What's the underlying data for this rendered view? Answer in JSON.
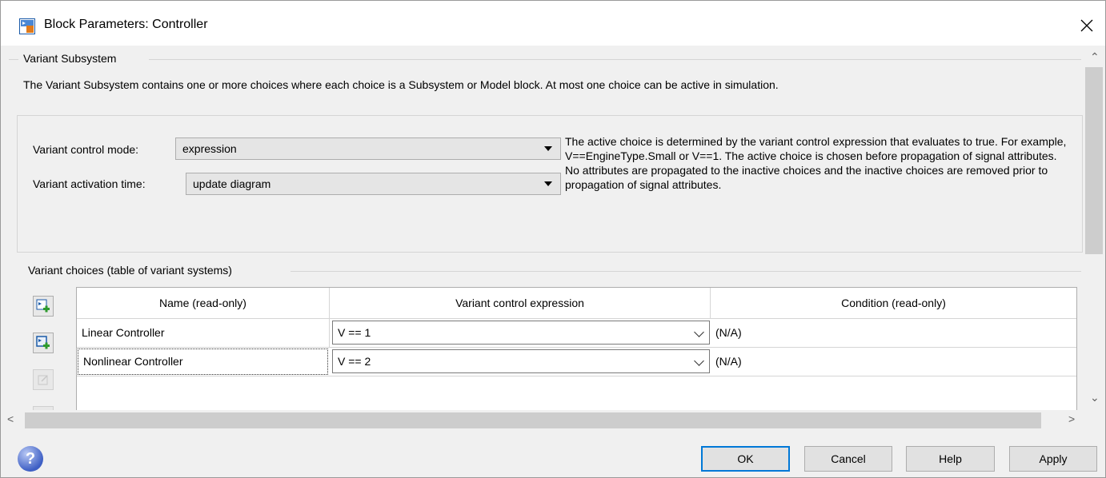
{
  "window": {
    "title": "Block Parameters: Controller"
  },
  "group1": {
    "label": "Variant Subsystem",
    "description": "The Variant Subsystem contains one or more choices where each choice is a Subsystem or Model block. At most one choice can be active in simulation."
  },
  "controls": {
    "mode_label": "Variant control mode:",
    "mode_value": "expression",
    "activation_label": "Variant activation time:",
    "activation_value": "update diagram",
    "info": "The active choice is determined by the variant control expression that evaluates to true. For example, V==EngineType.Small or V==1. The active choice is chosen before propagation of signal attributes. No attributes are propagated to the inactive choices and the inactive choices are removed prior to propagation of signal attributes."
  },
  "choices": {
    "label": "Variant choices (table of variant systems)",
    "columns": [
      "Name (read-only)",
      "Variant control expression",
      "Condition (read-only)"
    ],
    "rows": [
      {
        "name": "Linear Controller",
        "expression": "V == 1",
        "condition": "(N/A)"
      },
      {
        "name": "Nonlinear Controller",
        "expression": "V == 2",
        "condition": "(N/A)"
      }
    ]
  },
  "buttons": {
    "ok": "OK",
    "cancel": "Cancel",
    "help": "Help",
    "apply": "Apply"
  },
  "icons": {
    "app": "simulink-block-icon",
    "close": "close-icon",
    "help": "help-icon",
    "add_choice": "add-subsystem-choice-icon",
    "add_model": "add-model-choice-icon",
    "edit": "edit-icon"
  },
  "colors": {
    "accent": "#0078d7",
    "help_icon": "#3e5fc4"
  }
}
